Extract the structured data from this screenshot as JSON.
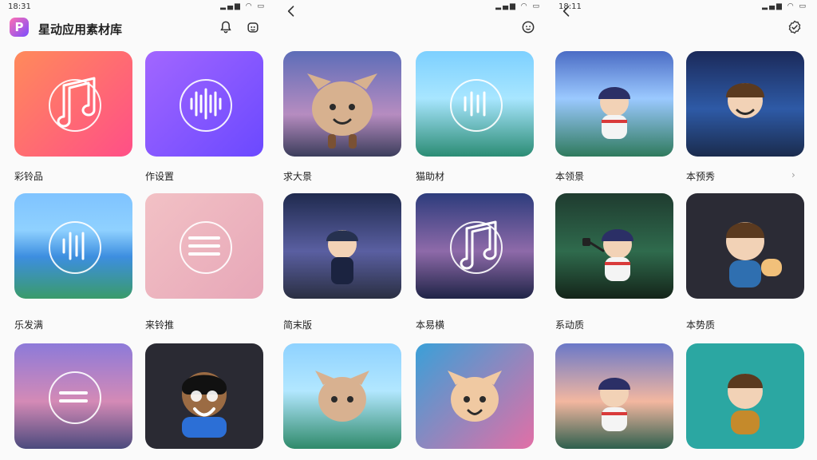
{
  "status_bar": {
    "time_1": "18:31",
    "time_3": "18:11"
  },
  "header": {
    "app_title": "星动应用素材库"
  },
  "pane1": {
    "tiles": [
      {
        "label": "彩铃品"
      },
      {
        "label": "作设置"
      },
      {
        "label": "乐发满"
      },
      {
        "label": "来铃推"
      },
      {
        "label": ""
      },
      {
        "label": ""
      }
    ]
  },
  "pane2": {
    "tiles": [
      {
        "label": "求大景"
      },
      {
        "label": "猫助材"
      },
      {
        "label": "简末版"
      },
      {
        "label": "本易横"
      },
      {
        "label": ""
      },
      {
        "label": ""
      }
    ]
  },
  "pane3": {
    "tiles": [
      {
        "label": "本领景"
      },
      {
        "label": "本预秀"
      },
      {
        "label": "系动质"
      },
      {
        "label": "本势质"
      },
      {
        "label": ""
      },
      {
        "label": ""
      }
    ]
  },
  "colors": {
    "accent_gradient_start": "#ff6fb1",
    "accent_gradient_end": "#7a4dff",
    "text": "#222222"
  }
}
